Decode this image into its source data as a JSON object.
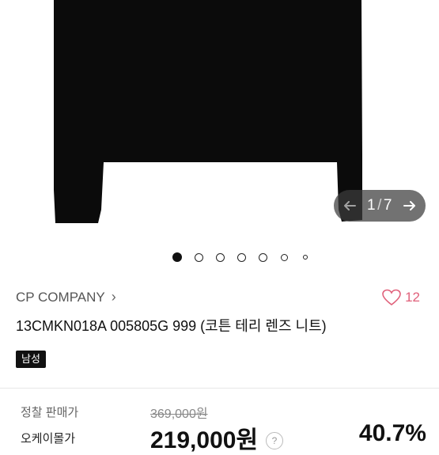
{
  "gallery": {
    "current": "1",
    "separator": "/",
    "total": "7",
    "prev_icon": "arrow-left-icon",
    "next_icon": "arrow-right-icon",
    "image_color": "#0b0b0b",
    "dots": [
      {
        "active": true
      },
      {
        "active": false
      },
      {
        "active": false
      },
      {
        "active": false
      },
      {
        "active": false
      },
      {
        "active": false
      },
      {
        "active": false
      }
    ]
  },
  "product": {
    "brand": "CP COMPANY",
    "brand_chevron": "›",
    "like_icon": "heart-outline-icon",
    "like_color": "#e0607a",
    "like_count": "12",
    "title": "13CMKN018A 005805G 999 (코튼 테리 렌즈 니트)",
    "tag": "남성"
  },
  "pricing": {
    "list_price_label": "정찰 판매가",
    "list_price": "369,000원",
    "sale_price_label": "오케이몰가",
    "sale_price": "219,000원",
    "info_icon": "question-icon",
    "info_glyph": "?",
    "discount": "40.7%"
  }
}
